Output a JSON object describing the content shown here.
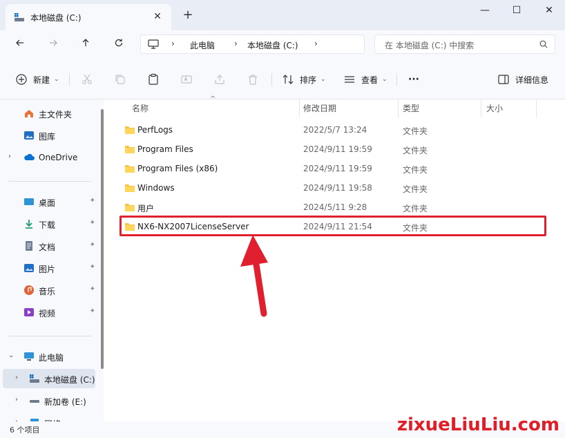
{
  "window": {
    "tab_title": "本地磁盘 (C:)",
    "tab_icon": "drive-icon",
    "new_tab_glyph": "+",
    "close_tab_glyph": "✕",
    "minimize_glyph": "—",
    "maximize_glyph": "☐",
    "close_glyph": "✕"
  },
  "address": {
    "crumbs": [
      "此电脑",
      "本地磁盘 (C:)"
    ],
    "search_placeholder": "在 本地磁盘 (C:) 中搜索"
  },
  "toolbar": {
    "new_label": "新建",
    "sort_label": "排序",
    "view_label": "查看",
    "more_label": "···",
    "details_label": "详细信息"
  },
  "sidebar": {
    "top": [
      {
        "label": "主文件夹",
        "icon": "home-icon"
      },
      {
        "label": "图库",
        "icon": "gallery-icon"
      },
      {
        "label": "OneDrive",
        "icon": "cloud-icon"
      }
    ],
    "pinned": [
      {
        "label": "桌面",
        "icon": "desktop-icon"
      },
      {
        "label": "下载",
        "icon": "download-icon"
      },
      {
        "label": "文档",
        "icon": "document-icon"
      },
      {
        "label": "图片",
        "icon": "pictures-icon"
      },
      {
        "label": "音乐",
        "icon": "music-icon"
      },
      {
        "label": "视频",
        "icon": "video-icon"
      }
    ],
    "pin_glyph": "📌",
    "pc": {
      "label": "此电脑",
      "icon": "pc-icon"
    },
    "drives": [
      {
        "label": "本地磁盘 (C:)",
        "icon": "drive-icon",
        "selected": true
      },
      {
        "label": "新加卷 (E:)",
        "icon": "drive-icon",
        "selected": false
      }
    ],
    "partial_label": "网络"
  },
  "columns": {
    "name": "名称",
    "date": "修改日期",
    "type": "类型",
    "size": "大小"
  },
  "files": [
    {
      "name": "PerfLogs",
      "date": "2022/5/7 13:24",
      "type": "文件夹"
    },
    {
      "name": "Program Files",
      "date": "2024/9/11 19:59",
      "type": "文件夹"
    },
    {
      "name": "Program Files (x86)",
      "date": "2024/9/11 19:59",
      "type": "文件夹"
    },
    {
      "name": "Windows",
      "date": "2024/9/11 19:58",
      "type": "文件夹"
    },
    {
      "name": "用户",
      "date": "2024/5/11 9:28",
      "type": "文件夹"
    },
    {
      "name": "NX6-NX2007LicenseServer",
      "date": "2024/9/11 21:54",
      "type": "文件夹",
      "highlighted": true
    }
  ],
  "status": {
    "count_text": "6 个项目"
  },
  "watermark": "zixueLiuLiu.com",
  "colors": {
    "highlight": "#e0202e",
    "folder": "#f4c542",
    "accent": "#0067c0"
  }
}
